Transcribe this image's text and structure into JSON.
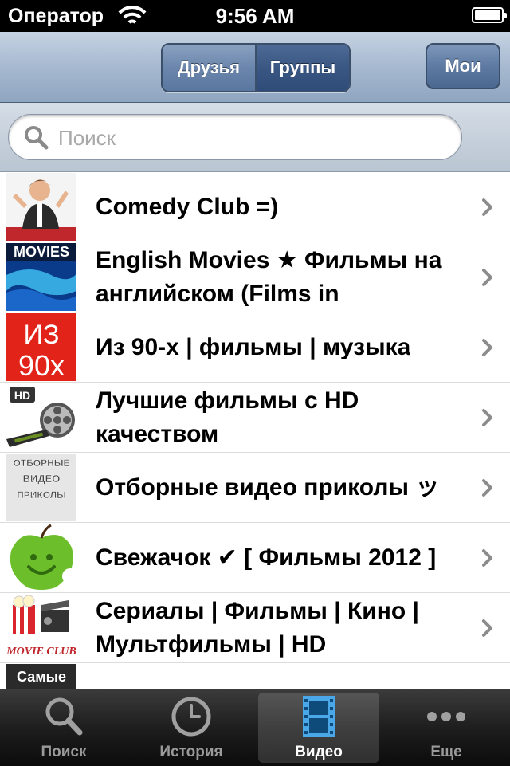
{
  "status_bar": {
    "carrier": "Оператор",
    "time": "9:56 AM"
  },
  "nav": {
    "segments": [
      "Друзья",
      "Группы"
    ],
    "selected_segment": "Группы",
    "right_button": "Мои"
  },
  "search": {
    "placeholder": "Поиск"
  },
  "groups": [
    {
      "title": "Comedy Club =)",
      "thumb": "comedy-club-thumbnail"
    },
    {
      "title": "English Movies ★ Фильмы на английском (Films in",
      "thumb": "movies-thumbnail"
    },
    {
      "title": "Из 90-х | фильмы | музыка",
      "thumb": "iz-90x-thumbnail"
    },
    {
      "title": "Лучшие фильмы с HD качеством",
      "thumb": "hd-film-reel-thumbnail"
    },
    {
      "title": "Отборные видео приколы ッ",
      "thumb": "otbornye-video-prikoly-thumbnail"
    },
    {
      "title": "Свежачок ✔ [ Фильмы 2012 ]",
      "thumb": "green-apple-thumbnail"
    },
    {
      "title": "Сериалы | Фильмы | Кино | Мультфильмы | HD",
      "thumb": "movie-club-thumbnail"
    },
    {
      "title": "",
      "thumb": "samye-thumbnail"
    }
  ],
  "thumb_text": {
    "movies": "MOVIES",
    "iz": "ИЗ",
    "iz_year": "90х",
    "hd": "HD",
    "otbor_1": "ОТБОРНЫЕ",
    "otbor_2": "ВИДЕО",
    "otbor_3": "ПРИКОЛЫ",
    "movie_club": "MOVIE CLUB",
    "samye": "Самые"
  },
  "tabs": [
    {
      "label": "Поиск",
      "icon": "search-icon"
    },
    {
      "label": "История",
      "icon": "clock-icon"
    },
    {
      "label": "Видео",
      "icon": "film-strip-icon"
    },
    {
      "label": "Еще",
      "icon": "more-dots-icon"
    }
  ],
  "selected_tab": "Видео",
  "colors": {
    "navbar": "#9fb3cb",
    "segment_active": "#34507d",
    "tab_selected_icon": "#4aa8e8"
  }
}
